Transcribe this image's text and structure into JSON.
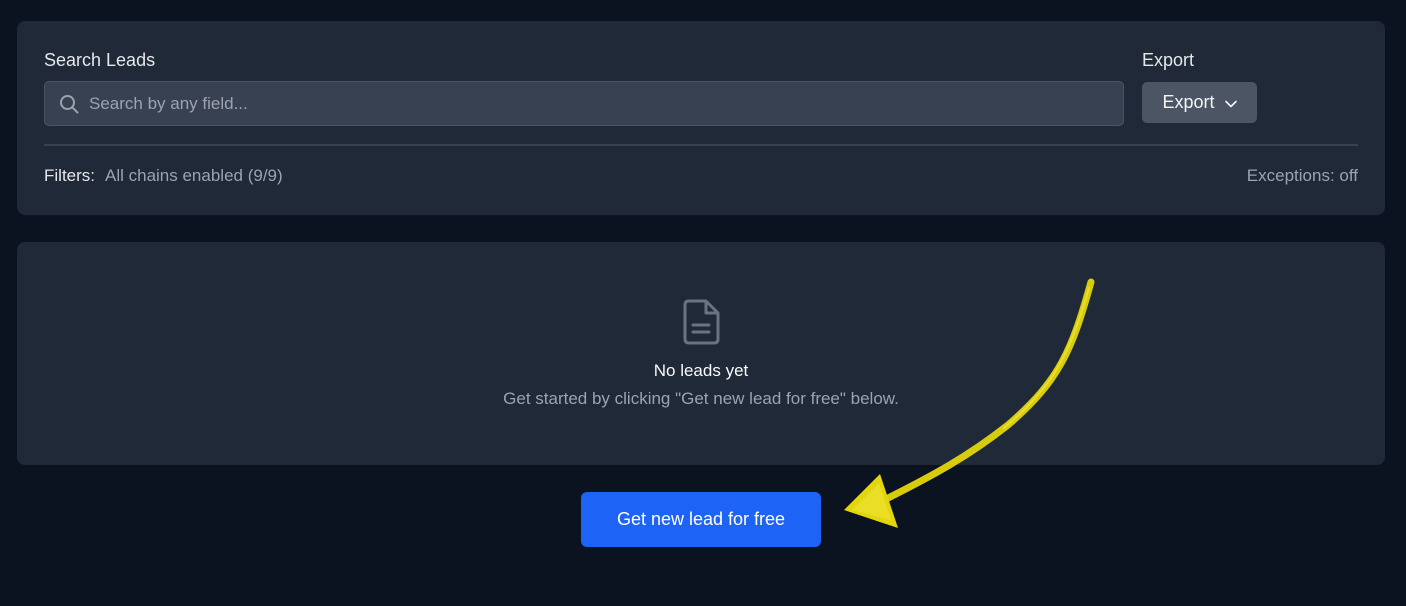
{
  "search": {
    "label": "Search Leads",
    "placeholder": "Search by any field...",
    "value": ""
  },
  "export": {
    "label": "Export",
    "button_label": "Export"
  },
  "filters": {
    "key": "Filters:",
    "value": "All chains enabled (9/9)",
    "exceptions": "Exceptions: off"
  },
  "empty_state": {
    "title": "No leads yet",
    "subtitle": "Get started by clicking \"Get new lead for free\" below.",
    "icon": "document-icon"
  },
  "cta": {
    "label": "Get new lead for free"
  },
  "annotation": {
    "icon": "hand-drawn-arrow-icon",
    "color": "#e3d60a"
  },
  "colors": {
    "background": "#0b1220",
    "card": "#1f2937",
    "primary": "#1d63f5"
  }
}
